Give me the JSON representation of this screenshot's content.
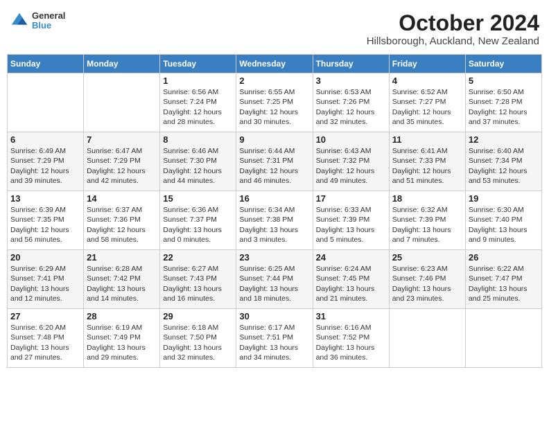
{
  "header": {
    "logo_line1": "General",
    "logo_line2": "Blue",
    "month": "October 2024",
    "location": "Hillsborough, Auckland, New Zealand"
  },
  "days_of_week": [
    "Sunday",
    "Monday",
    "Tuesday",
    "Wednesday",
    "Thursday",
    "Friday",
    "Saturday"
  ],
  "weeks": [
    [
      {
        "day": "",
        "detail": ""
      },
      {
        "day": "",
        "detail": ""
      },
      {
        "day": "1",
        "detail": "Sunrise: 6:56 AM\nSunset: 7:24 PM\nDaylight: 12 hours and 28 minutes."
      },
      {
        "day": "2",
        "detail": "Sunrise: 6:55 AM\nSunset: 7:25 PM\nDaylight: 12 hours and 30 minutes."
      },
      {
        "day": "3",
        "detail": "Sunrise: 6:53 AM\nSunset: 7:26 PM\nDaylight: 12 hours and 32 minutes."
      },
      {
        "day": "4",
        "detail": "Sunrise: 6:52 AM\nSunset: 7:27 PM\nDaylight: 12 hours and 35 minutes."
      },
      {
        "day": "5",
        "detail": "Sunrise: 6:50 AM\nSunset: 7:28 PM\nDaylight: 12 hours and 37 minutes."
      }
    ],
    [
      {
        "day": "6",
        "detail": "Sunrise: 6:49 AM\nSunset: 7:29 PM\nDaylight: 12 hours and 39 minutes."
      },
      {
        "day": "7",
        "detail": "Sunrise: 6:47 AM\nSunset: 7:29 PM\nDaylight: 12 hours and 42 minutes."
      },
      {
        "day": "8",
        "detail": "Sunrise: 6:46 AM\nSunset: 7:30 PM\nDaylight: 12 hours and 44 minutes."
      },
      {
        "day": "9",
        "detail": "Sunrise: 6:44 AM\nSunset: 7:31 PM\nDaylight: 12 hours and 46 minutes."
      },
      {
        "day": "10",
        "detail": "Sunrise: 6:43 AM\nSunset: 7:32 PM\nDaylight: 12 hours and 49 minutes."
      },
      {
        "day": "11",
        "detail": "Sunrise: 6:41 AM\nSunset: 7:33 PM\nDaylight: 12 hours and 51 minutes."
      },
      {
        "day": "12",
        "detail": "Sunrise: 6:40 AM\nSunset: 7:34 PM\nDaylight: 12 hours and 53 minutes."
      }
    ],
    [
      {
        "day": "13",
        "detail": "Sunrise: 6:39 AM\nSunset: 7:35 PM\nDaylight: 12 hours and 56 minutes."
      },
      {
        "day": "14",
        "detail": "Sunrise: 6:37 AM\nSunset: 7:36 PM\nDaylight: 12 hours and 58 minutes."
      },
      {
        "day": "15",
        "detail": "Sunrise: 6:36 AM\nSunset: 7:37 PM\nDaylight: 13 hours and 0 minutes."
      },
      {
        "day": "16",
        "detail": "Sunrise: 6:34 AM\nSunset: 7:38 PM\nDaylight: 13 hours and 3 minutes."
      },
      {
        "day": "17",
        "detail": "Sunrise: 6:33 AM\nSunset: 7:39 PM\nDaylight: 13 hours and 5 minutes."
      },
      {
        "day": "18",
        "detail": "Sunrise: 6:32 AM\nSunset: 7:39 PM\nDaylight: 13 hours and 7 minutes."
      },
      {
        "day": "19",
        "detail": "Sunrise: 6:30 AM\nSunset: 7:40 PM\nDaylight: 13 hours and 9 minutes."
      }
    ],
    [
      {
        "day": "20",
        "detail": "Sunrise: 6:29 AM\nSunset: 7:41 PM\nDaylight: 13 hours and 12 minutes."
      },
      {
        "day": "21",
        "detail": "Sunrise: 6:28 AM\nSunset: 7:42 PM\nDaylight: 13 hours and 14 minutes."
      },
      {
        "day": "22",
        "detail": "Sunrise: 6:27 AM\nSunset: 7:43 PM\nDaylight: 13 hours and 16 minutes."
      },
      {
        "day": "23",
        "detail": "Sunrise: 6:25 AM\nSunset: 7:44 PM\nDaylight: 13 hours and 18 minutes."
      },
      {
        "day": "24",
        "detail": "Sunrise: 6:24 AM\nSunset: 7:45 PM\nDaylight: 13 hours and 21 minutes."
      },
      {
        "day": "25",
        "detail": "Sunrise: 6:23 AM\nSunset: 7:46 PM\nDaylight: 13 hours and 23 minutes."
      },
      {
        "day": "26",
        "detail": "Sunrise: 6:22 AM\nSunset: 7:47 PM\nDaylight: 13 hours and 25 minutes."
      }
    ],
    [
      {
        "day": "27",
        "detail": "Sunrise: 6:20 AM\nSunset: 7:48 PM\nDaylight: 13 hours and 27 minutes."
      },
      {
        "day": "28",
        "detail": "Sunrise: 6:19 AM\nSunset: 7:49 PM\nDaylight: 13 hours and 29 minutes."
      },
      {
        "day": "29",
        "detail": "Sunrise: 6:18 AM\nSunset: 7:50 PM\nDaylight: 13 hours and 32 minutes."
      },
      {
        "day": "30",
        "detail": "Sunrise: 6:17 AM\nSunset: 7:51 PM\nDaylight: 13 hours and 34 minutes."
      },
      {
        "day": "31",
        "detail": "Sunrise: 6:16 AM\nSunset: 7:52 PM\nDaylight: 13 hours and 36 minutes."
      },
      {
        "day": "",
        "detail": ""
      },
      {
        "day": "",
        "detail": ""
      }
    ]
  ]
}
